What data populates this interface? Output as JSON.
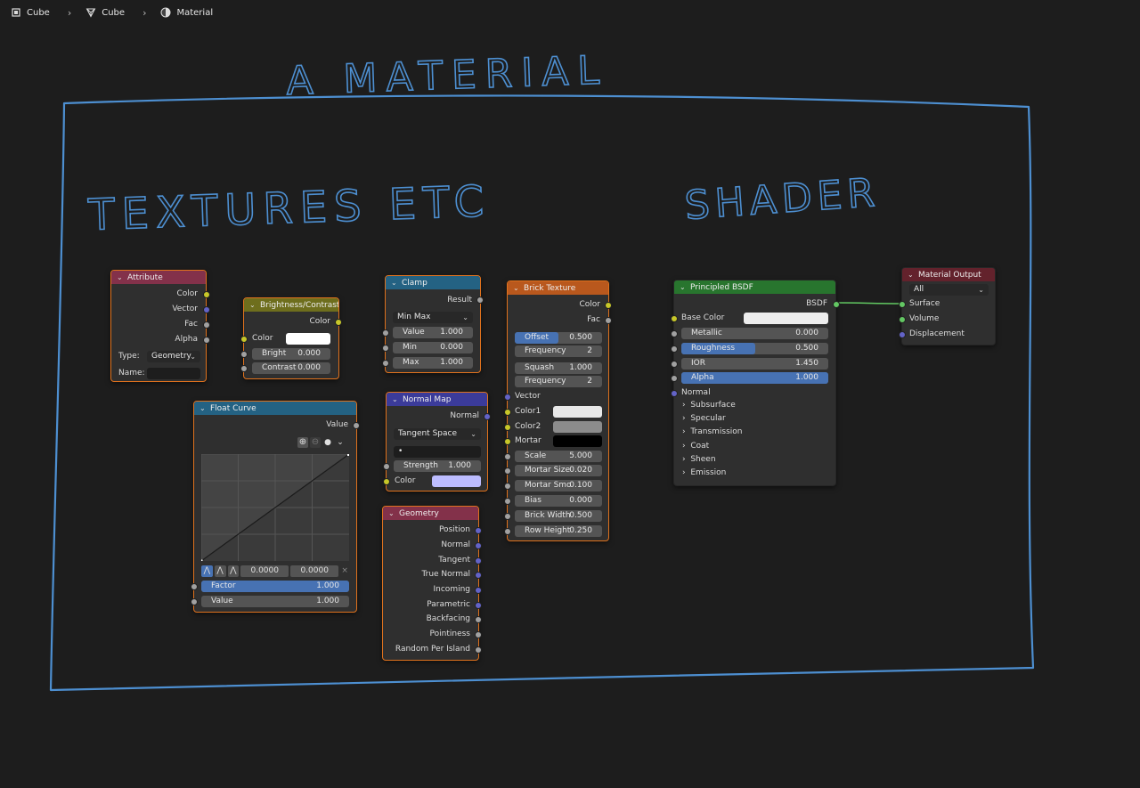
{
  "breadcrumb": {
    "items": [
      {
        "label": "Cube",
        "icon": "object-icon"
      },
      {
        "label": "Cube",
        "icon": "mesh-icon"
      },
      {
        "label": "Material",
        "icon": "material-icon"
      }
    ]
  },
  "annotations": {
    "title": "A MATERIAL",
    "left": "TEXTURES ETC",
    "right": "SHADER"
  },
  "colors": {
    "frame": "#4d8fd1",
    "wire": "#62c962",
    "node_selected_outline": "#e0721d",
    "header_input": "#83314a",
    "header_texture": "#b9581d",
    "header_converter": "#246283",
    "header_color": "#6e6e1d",
    "header_vector": "#3b3b9a",
    "header_shader": "#28752e",
    "header_output": "#63222c"
  },
  "nodes": {
    "attribute": {
      "title": "Attribute",
      "outputs": [
        "Color",
        "Vector",
        "Fac",
        "Alpha"
      ],
      "type_label": "Type:",
      "type_value": "Geometry",
      "name_label": "Name:"
    },
    "bright": {
      "title": "Brightness/Contrast",
      "out": "Color",
      "color_label": "Color",
      "bright_label": "Bright",
      "bright_value": "0.000",
      "contrast_label": "Contrast",
      "contrast_value": "0.000"
    },
    "clamp": {
      "title": "Clamp",
      "out": "Result",
      "mode": "Min Max",
      "value_label": "Value",
      "value": "1.000",
      "min_label": "Min",
      "min": "0.000",
      "max_label": "Max",
      "max": "1.000"
    },
    "normalmap": {
      "title": "Normal Map",
      "out": "Normal",
      "space": "Tangent Space",
      "uv": "•",
      "strength_label": "Strength",
      "strength": "1.000",
      "color_label": "Color"
    },
    "geometry": {
      "title": "Geometry",
      "outputs": [
        "Position",
        "Normal",
        "Tangent",
        "True Normal",
        "Incoming",
        "Parametric",
        "Backfacing",
        "Pointiness",
        "Random Per Island"
      ]
    },
    "floatcurve": {
      "title": "Float Curve",
      "out": "Value",
      "x_value": "0.0000",
      "y_value": "0.0000",
      "factor_label": "Factor",
      "factor": "1.000",
      "factor_level": 1.0,
      "value_label": "Value",
      "value": "1.000"
    },
    "brick": {
      "title": "Brick Texture",
      "out_color": "Color",
      "out_fac": "Fac",
      "offset_label": "Offset",
      "offset": "0.500",
      "offset_level": 0.5,
      "freq1_label": "Frequency",
      "freq1": "2",
      "squash_label": "Squash",
      "squash": "1.000",
      "freq2_label": "Frequency",
      "freq2": "2",
      "in_vector": "Vector",
      "in_color1": "Color1",
      "in_color2": "Color2",
      "in_mortar": "Mortar",
      "scale_label": "Scale",
      "scale": "5.000",
      "mortar_size_label": "Mortar Size",
      "mortar_size": "0.020",
      "mortar_smooth_label": "Mortar Smo",
      "mortar_smooth": "0.100",
      "bias_label": "Bias",
      "bias": "0.000",
      "brick_width_label": "Brick Width",
      "brick_width": "0.500",
      "row_height_label": "Row Height",
      "row_height": "0.250"
    },
    "bsdf": {
      "title": "Principled BSDF",
      "out": "BSDF",
      "base_color_label": "Base Color",
      "metallic_label": "Metallic",
      "metallic": "0.000",
      "roughness_label": "Roughness",
      "roughness": "0.500",
      "roughness_level": 0.5,
      "ior_label": "IOR",
      "ior": "1.450",
      "alpha_label": "Alpha",
      "alpha": "1.000",
      "alpha_level": 1.0,
      "normal_label": "Normal",
      "panels": [
        "Subsurface",
        "Specular",
        "Transmission",
        "Coat",
        "Sheen",
        "Emission"
      ]
    },
    "output": {
      "title": "Material Output",
      "target": "All",
      "inputs": [
        "Surface",
        "Volume",
        "Displacement"
      ]
    }
  }
}
